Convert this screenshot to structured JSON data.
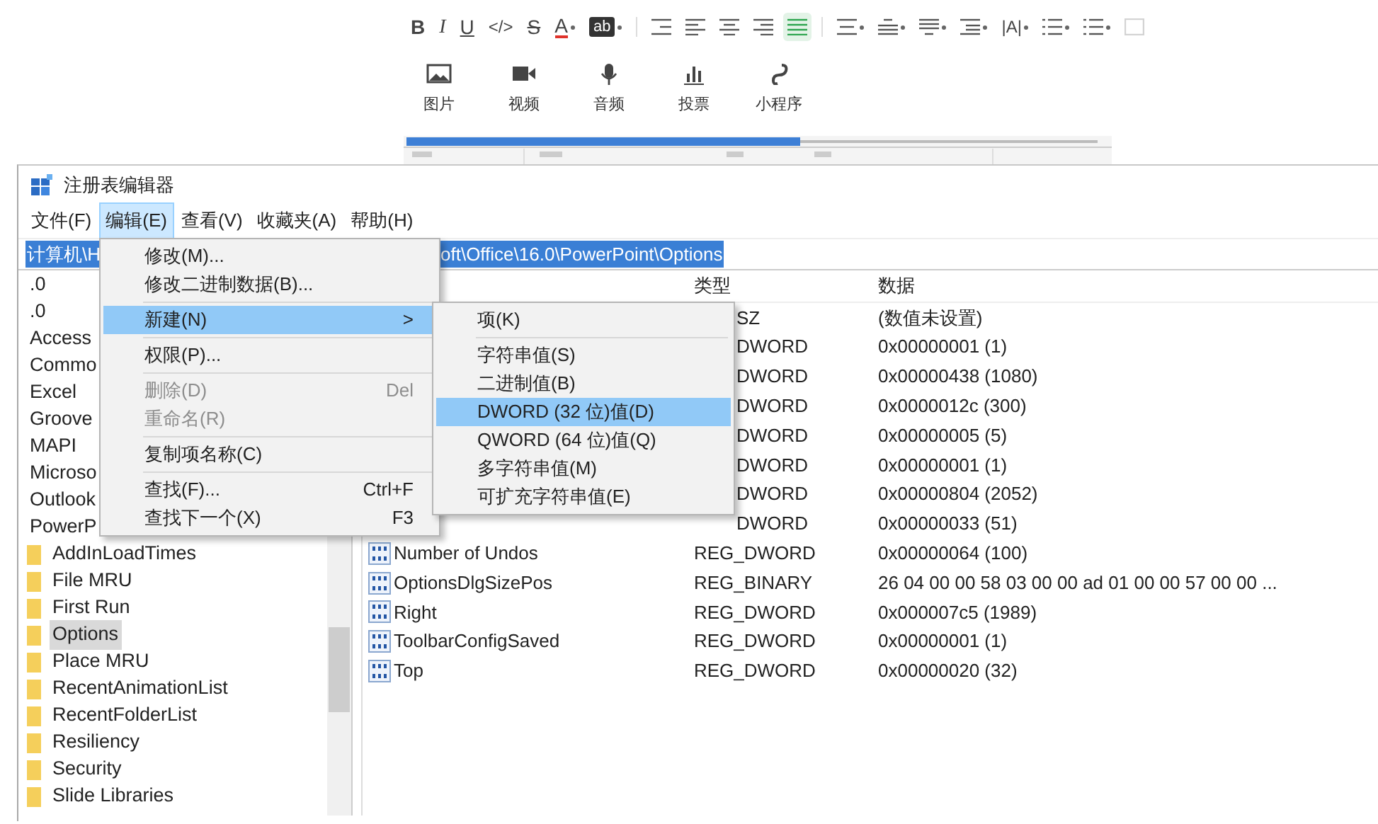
{
  "editor_toolbar": {
    "items": [
      {
        "kind": "bold",
        "label": "B",
        "dropdown": false,
        "selected": false,
        "disabled": false
      },
      {
        "kind": "italic",
        "label": "I",
        "dropdown": false,
        "selected": false,
        "disabled": false
      },
      {
        "kind": "underline",
        "label": "U",
        "dropdown": false,
        "selected": false,
        "disabled": false
      },
      {
        "kind": "plain",
        "label": "</>",
        "dropdown": false,
        "selected": false,
        "disabled": false
      },
      {
        "kind": "strike",
        "label": "S",
        "dropdown": false,
        "selected": false,
        "disabled": false
      },
      {
        "kind": "color",
        "label": "A",
        "dropdown": true,
        "selected": false,
        "disabled": false
      },
      {
        "kind": "highlight",
        "label": "ab",
        "dropdown": true,
        "selected": false,
        "disabled": false
      },
      {
        "kind": "icon",
        "dropdown": false,
        "selected": false,
        "disabled": false
      },
      {
        "kind": "icon",
        "dropdown": false,
        "selected": false,
        "disabled": false
      },
      {
        "kind": "icon",
        "dropdown": false,
        "selected": false,
        "disabled": false
      },
      {
        "kind": "icon",
        "dropdown": false,
        "selected": false,
        "disabled": false
      },
      {
        "kind": "icon",
        "dropdown": false,
        "selected": true,
        "disabled": false
      },
      {
        "kind": "icon",
        "dropdown": true,
        "selected": false,
        "disabled": false
      },
      {
        "kind": "icon",
        "dropdown": true,
        "selected": false,
        "disabled": false
      },
      {
        "kind": "icon",
        "dropdown": true,
        "selected": false,
        "disabled": false
      },
      {
        "kind": "icon",
        "dropdown": true,
        "selected": false,
        "disabled": false
      },
      {
        "kind": "plain",
        "label": "|A|",
        "dropdown": true,
        "selected": false,
        "disabled": false
      },
      {
        "kind": "icon",
        "dropdown": true,
        "selected": false,
        "disabled": false
      },
      {
        "kind": "icon",
        "dropdown": true,
        "selected": false,
        "disabled": false
      },
      {
        "kind": "icon",
        "dropdown": false,
        "selected": false,
        "disabled": true
      }
    ]
  },
  "insert_bar": {
    "items": [
      {
        "label": "图片"
      },
      {
        "label": "视频"
      },
      {
        "label": "音频"
      },
      {
        "label": "投票"
      },
      {
        "label": "小程序"
      }
    ]
  },
  "registry_window": {
    "title": "注册表编辑器",
    "menu": [
      {
        "label": "文件(F)",
        "selected": false
      },
      {
        "label": "编辑(E)",
        "selected": true
      },
      {
        "label": "查看(V)",
        "selected": false
      },
      {
        "label": "收藏夹(A)",
        "selected": false
      },
      {
        "label": "帮助(H)",
        "selected": false
      }
    ],
    "address": {
      "start": "计算机\\H",
      "end": "oft\\Office\\16.0\\PowerPoint\\Options"
    },
    "tree": {
      "items": [
        {
          "kind": "plain",
          "label": ".0",
          "selected": false
        },
        {
          "kind": "plain",
          "label": ".0",
          "selected": false
        },
        {
          "kind": "plain",
          "label": "Access",
          "selected": false
        },
        {
          "kind": "plain",
          "label": "Commo",
          "selected": false
        },
        {
          "kind": "plain",
          "label": "Excel",
          "selected": false
        },
        {
          "kind": "plain",
          "label": "Groove",
          "selected": false
        },
        {
          "kind": "plain",
          "label": "MAPI",
          "selected": false
        },
        {
          "kind": "plain",
          "label": "Microso",
          "selected": false
        },
        {
          "kind": "plain",
          "label": "Outlook",
          "selected": false
        },
        {
          "kind": "plain",
          "label": "PowerP",
          "selected": false
        },
        {
          "kind": "folder",
          "label": "AddInLoadTimes",
          "selected": false
        },
        {
          "kind": "folder",
          "label": "File MRU",
          "selected": false
        },
        {
          "kind": "folder",
          "label": "First Run",
          "selected": false
        },
        {
          "kind": "folder",
          "label": "Options",
          "selected": true
        },
        {
          "kind": "folder",
          "label": "Place MRU",
          "selected": false
        },
        {
          "kind": "folder",
          "label": "RecentAnimationList",
          "selected": false
        },
        {
          "kind": "folder",
          "label": "RecentFolderList",
          "selected": false
        },
        {
          "kind": "folder",
          "label": "Resiliency",
          "selected": false
        },
        {
          "kind": "folder",
          "label": "Security",
          "selected": false
        },
        {
          "kind": "folder",
          "label": "Slide Libraries",
          "selected": false
        }
      ]
    },
    "values": {
      "columns": [
        "类型",
        "数据"
      ],
      "rows": [
        {
          "kind": "covered",
          "type": "SZ",
          "data": "(数值未设置)"
        },
        {
          "kind": "covered",
          "type": "DWORD",
          "data": "0x00000001 (1)"
        },
        {
          "kind": "covered",
          "type": "DWORD",
          "data": "0x00000438 (1080)"
        },
        {
          "kind": "covered",
          "type": "DWORD",
          "data": "0x0000012c (300)"
        },
        {
          "kind": "covered",
          "type": "DWORD",
          "data": "0x00000005 (5)"
        },
        {
          "kind": "covered",
          "type": "DWORD",
          "data": "0x00000001 (1)"
        },
        {
          "kind": "covered",
          "type": "DWORD",
          "data": "0x00000804 (2052)"
        },
        {
          "kind": "covered",
          "type": "DWORD",
          "data": "0x00000033 (51)"
        },
        {
          "kind": "full",
          "name": "Number of Undos",
          "type": "REG_DWORD",
          "data": "0x00000064 (100)"
        },
        {
          "kind": "full",
          "name": "OptionsDlgSizePos",
          "type": "REG_BINARY",
          "data": "26 04 00 00 58 03 00 00 ad 01 00 00 57 00 00 ..."
        },
        {
          "kind": "full",
          "name": "Right",
          "type": "REG_DWORD",
          "data": "0x000007c5 (1989)"
        },
        {
          "kind": "full",
          "name": "ToolbarConfigSaved",
          "type": "REG_DWORD",
          "data": "0x00000001 (1)"
        },
        {
          "kind": "full",
          "name": "Top",
          "type": "REG_DWORD",
          "data": "0x00000020 (32)"
        }
      ]
    },
    "edit_menu": {
      "items": [
        {
          "kind": "item",
          "label": "修改(M)...",
          "disabled": false,
          "selected": false
        },
        {
          "kind": "item",
          "label": "修改二进制数据(B)...",
          "disabled": false,
          "selected": false
        },
        {
          "kind": "separator"
        },
        {
          "kind": "item",
          "label": "新建(N)",
          "arrow": ">",
          "disabled": false,
          "selected": true
        },
        {
          "kind": "separator"
        },
        {
          "kind": "item",
          "label": "权限(P)...",
          "disabled": false,
          "selected": false
        },
        {
          "kind": "separator"
        },
        {
          "kind": "item",
          "label": "删除(D)",
          "shortcut": "Del",
          "disabled": true,
          "selected": false
        },
        {
          "kind": "item",
          "label": "重命名(R)",
          "disabled": true,
          "selected": false
        },
        {
          "kind": "separator"
        },
        {
          "kind": "item",
          "label": "复制项名称(C)",
          "disabled": false,
          "selected": false
        },
        {
          "kind": "separator"
        },
        {
          "kind": "item",
          "label": "查找(F)...",
          "shortcut": "Ctrl+F",
          "disabled": false,
          "selected": false
        },
        {
          "kind": "item",
          "label": "查找下一个(X)",
          "shortcut": "F3",
          "disabled": false,
          "selected": false
        }
      ]
    },
    "new_submenu": {
      "items": [
        {
          "kind": "item",
          "label": "项(K)",
          "disabled": false,
          "selected": false
        },
        {
          "kind": "separator"
        },
        {
          "kind": "item",
          "label": "字符串值(S)",
          "disabled": false,
          "selected": false
        },
        {
          "kind": "item",
          "label": "二进制值(B)",
          "disabled": false,
          "selected": false
        },
        {
          "kind": "item",
          "label": "DWORD (32 位)值(D)",
          "disabled": false,
          "selected": true
        },
        {
          "kind": "item",
          "label": "QWORD (64 位)值(Q)",
          "disabled": false,
          "selected": false
        },
        {
          "kind": "item",
          "label": "多字符串值(M)",
          "disabled": false,
          "selected": false
        },
        {
          "kind": "item",
          "label": "可扩充字符串值(E)",
          "disabled": false,
          "selected": false
        }
      ]
    }
  }
}
